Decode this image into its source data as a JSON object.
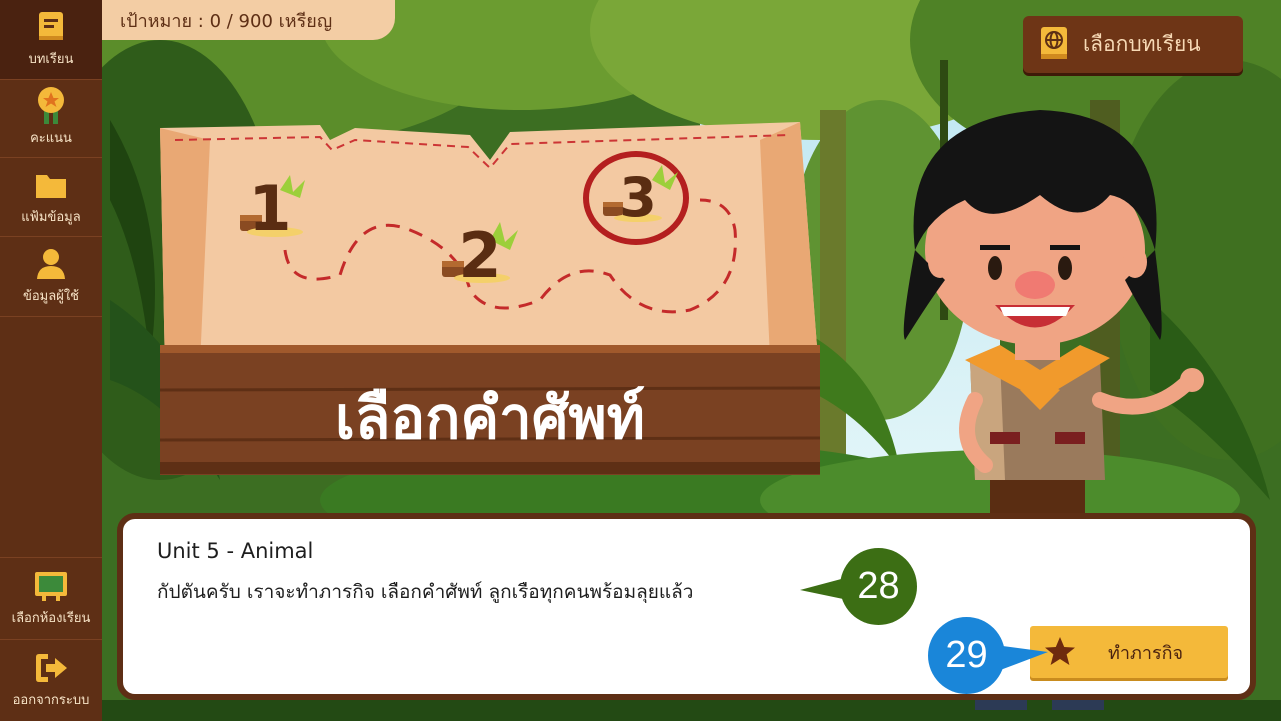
{
  "sidebar": {
    "items": [
      {
        "label": "บทเรียน",
        "icon": "book-icon"
      },
      {
        "label": "คะแนน",
        "icon": "medal-icon"
      },
      {
        "label": "แฟ้มข้อมูล",
        "icon": "folder-icon"
      },
      {
        "label": "ข้อมูลผู้ใช้",
        "icon": "user-icon"
      },
      {
        "label": "เลือกห้องเรียน",
        "icon": "classroom-board-icon"
      },
      {
        "label": "ออกจากระบบ",
        "icon": "logout-icon"
      }
    ]
  },
  "header": {
    "goal_text": "เป้าหมาย : 0 / 900 เหรียญ",
    "choose_lesson_label": "เลือกบทเรียน",
    "choose_lesson_icon": "globe-book-icon"
  },
  "map": {
    "steps": [
      "1",
      "2",
      "3"
    ],
    "current_step": "3",
    "sign_title": "เลือกคำศัพท์"
  },
  "dialog": {
    "unit": "Unit 5 - Animal",
    "text": "กัปตันครับ เราจะทำภารกิจ เลือกคำศัพท์ ลูกเรือทุกคนพร้อมลุยแล้ว",
    "mission_label": "ทำภารกิจ",
    "mission_icon": "star-icon"
  },
  "callouts": {
    "a": "28",
    "b": "29"
  },
  "colors": {
    "sidebar": "#5e2f15",
    "accent": "#f4b93a",
    "callout_green": "#3c6e14",
    "callout_blue": "#1a86d9"
  }
}
